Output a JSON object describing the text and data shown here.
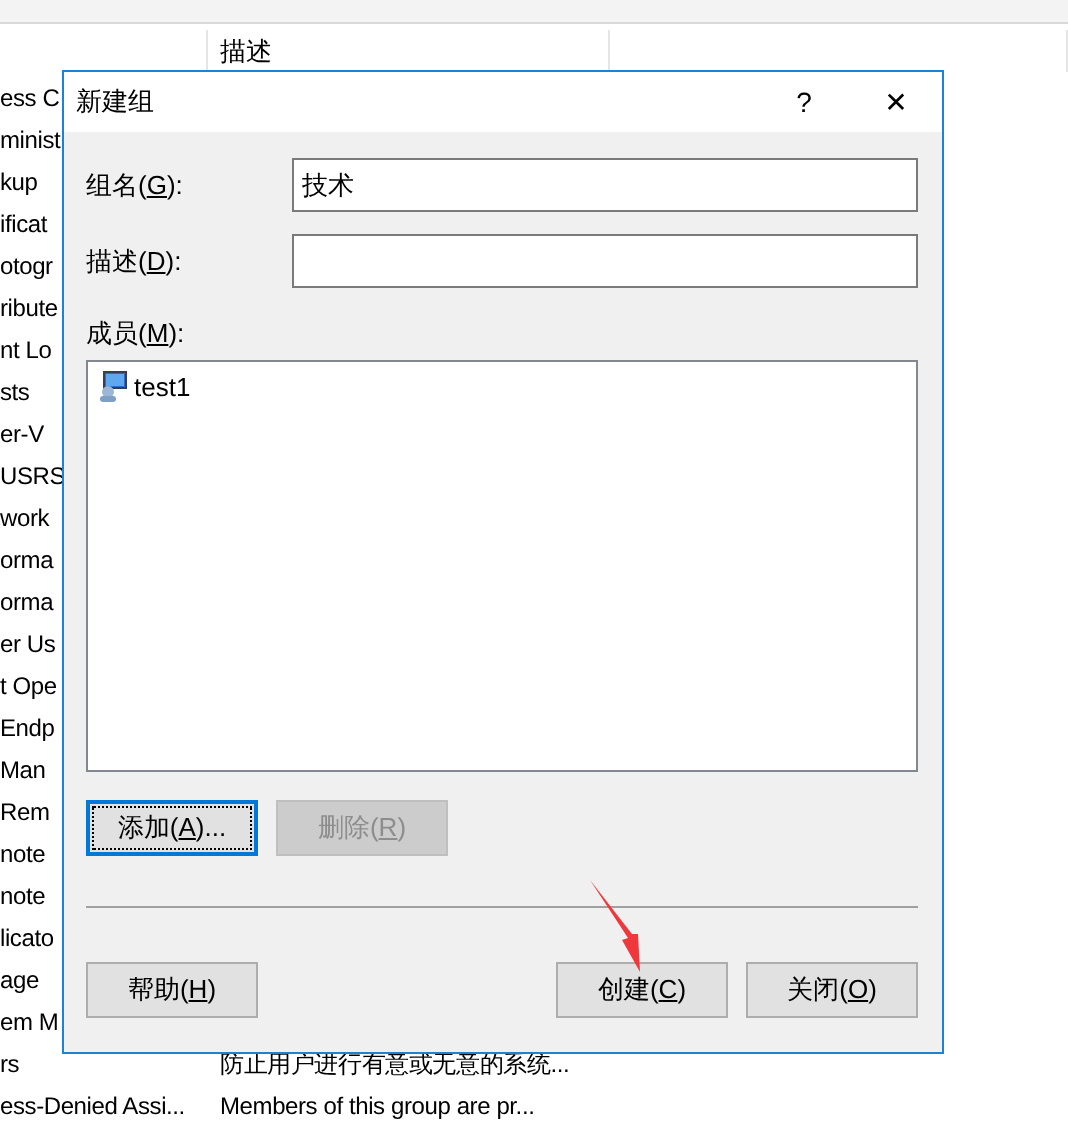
{
  "background_list": {
    "column_header": "描述",
    "rows": [
      {
        "name": "ess C"
      },
      {
        "name": "minist"
      },
      {
        "name": "kup"
      },
      {
        "name": "ificat"
      },
      {
        "name": "otogr"
      },
      {
        "name": "ribute"
      },
      {
        "name": "nt Lo"
      },
      {
        "name": "sts"
      },
      {
        "name": "er-V"
      },
      {
        "name": "USRS"
      },
      {
        "name": "work"
      },
      {
        "name": "orma"
      },
      {
        "name": "orma"
      },
      {
        "name": "er Us"
      },
      {
        "name": "t Ope"
      },
      {
        "name": "Endp"
      },
      {
        "name": "Man"
      },
      {
        "name": "Rem"
      },
      {
        "name": "note"
      },
      {
        "name": "note"
      },
      {
        "name": "licato"
      },
      {
        "name": "age"
      },
      {
        "name": "em M"
      },
      {
        "name": "rs",
        "description": "防止用户进行有意或无意的系统..."
      },
      {
        "name": "ess-Denied Assi...",
        "description": "Members of this group are pr..."
      }
    ]
  },
  "dialog": {
    "title": "新建组",
    "help": "?",
    "close": "✕",
    "fields": [
      {
        "label": {
          "before": "组名(",
          "key": "G",
          "after": "):"
        },
        "value": "技术"
      },
      {
        "label": {
          "before": "描述(",
          "key": "D",
          "after": "):"
        }
      }
    ],
    "members_label": {
      "before": "成员(",
      "key": "M",
      "after": "):"
    },
    "members": [
      {
        "name": "test1"
      }
    ],
    "member_buttons": [
      {
        "label": {
          "before": "添加(",
          "key": "A",
          "after": ")..."
        },
        "disabled": false,
        "focused": true
      },
      {
        "label": {
          "before": "删除(",
          "key": "R",
          "after": ")"
        },
        "disabled": true,
        "focused": false
      }
    ],
    "footer_left": [
      {
        "label": {
          "before": "帮助(",
          "key": "H",
          "after": ")"
        }
      }
    ],
    "footer_right": [
      {
        "label": {
          "before": "创建(",
          "key": "C",
          "after": ")"
        }
      },
      {
        "label": {
          "before": "关闭(",
          "key": "O",
          "after": ")"
        }
      }
    ]
  },
  "annotation": {
    "kind": "arrow"
  }
}
